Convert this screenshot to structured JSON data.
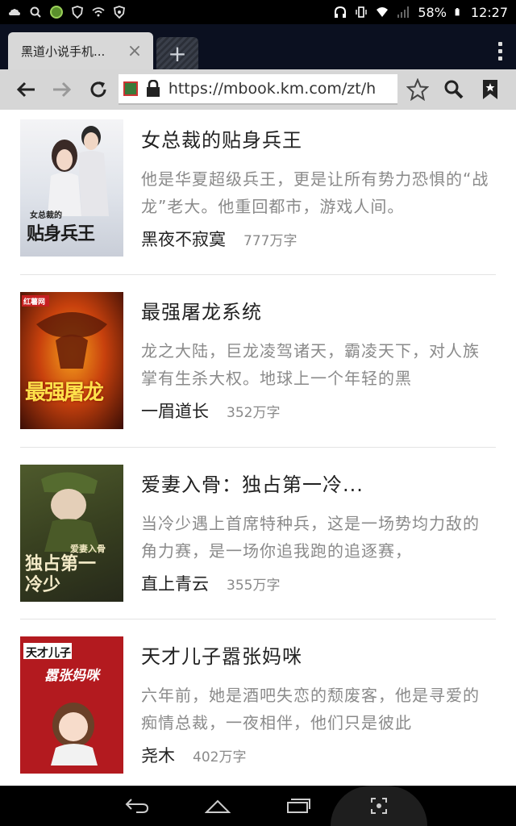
{
  "status_bar": {
    "battery": "58%",
    "time": "12:27"
  },
  "browser": {
    "tab_title": "黑道小说手机...",
    "url": "https://mbook.km.com/zt/h"
  },
  "books": [
    {
      "title": "女总裁的贴身兵王",
      "description": "他是华夏超级兵王，更是让所有势力恐惧的“战龙”老大。他重回都市，游戏人间。",
      "author": "黑夜不寂寞",
      "words": "777万字",
      "cover_text": "贴身兵王",
      "cover_top": "女总裁的"
    },
    {
      "title": "最强屠龙系统",
      "description": "龙之大陆，巨龙凌驾诸天，霸凌天下，对人族掌有生杀大权。地球上一个年轻的黑",
      "author": "一眉道长",
      "words": "352万字",
      "cover_text": "最强屠龙",
      "cover_top": "红薯网"
    },
    {
      "title": "爱妻入骨：独占第一冷...",
      "description": "当冷少遇上首席特种兵，这是一场势均力敌的角力赛，是一场你追我跑的追逐赛，",
      "author": "直上青云",
      "words": "355万字",
      "cover_text": "独占第一冷少",
      "cover_top": "爱妻入骨"
    },
    {
      "title": "天才儿子嚣张妈咪",
      "description": "六年前，她是酒吧失恋的颓废客，他是寻爱的痴情总裁，一夜相伴，他们只是彼此",
      "author": "尧木",
      "words": "402万字",
      "cover_text": "天才儿子",
      "cover_top": "嚣张妈咪"
    }
  ]
}
